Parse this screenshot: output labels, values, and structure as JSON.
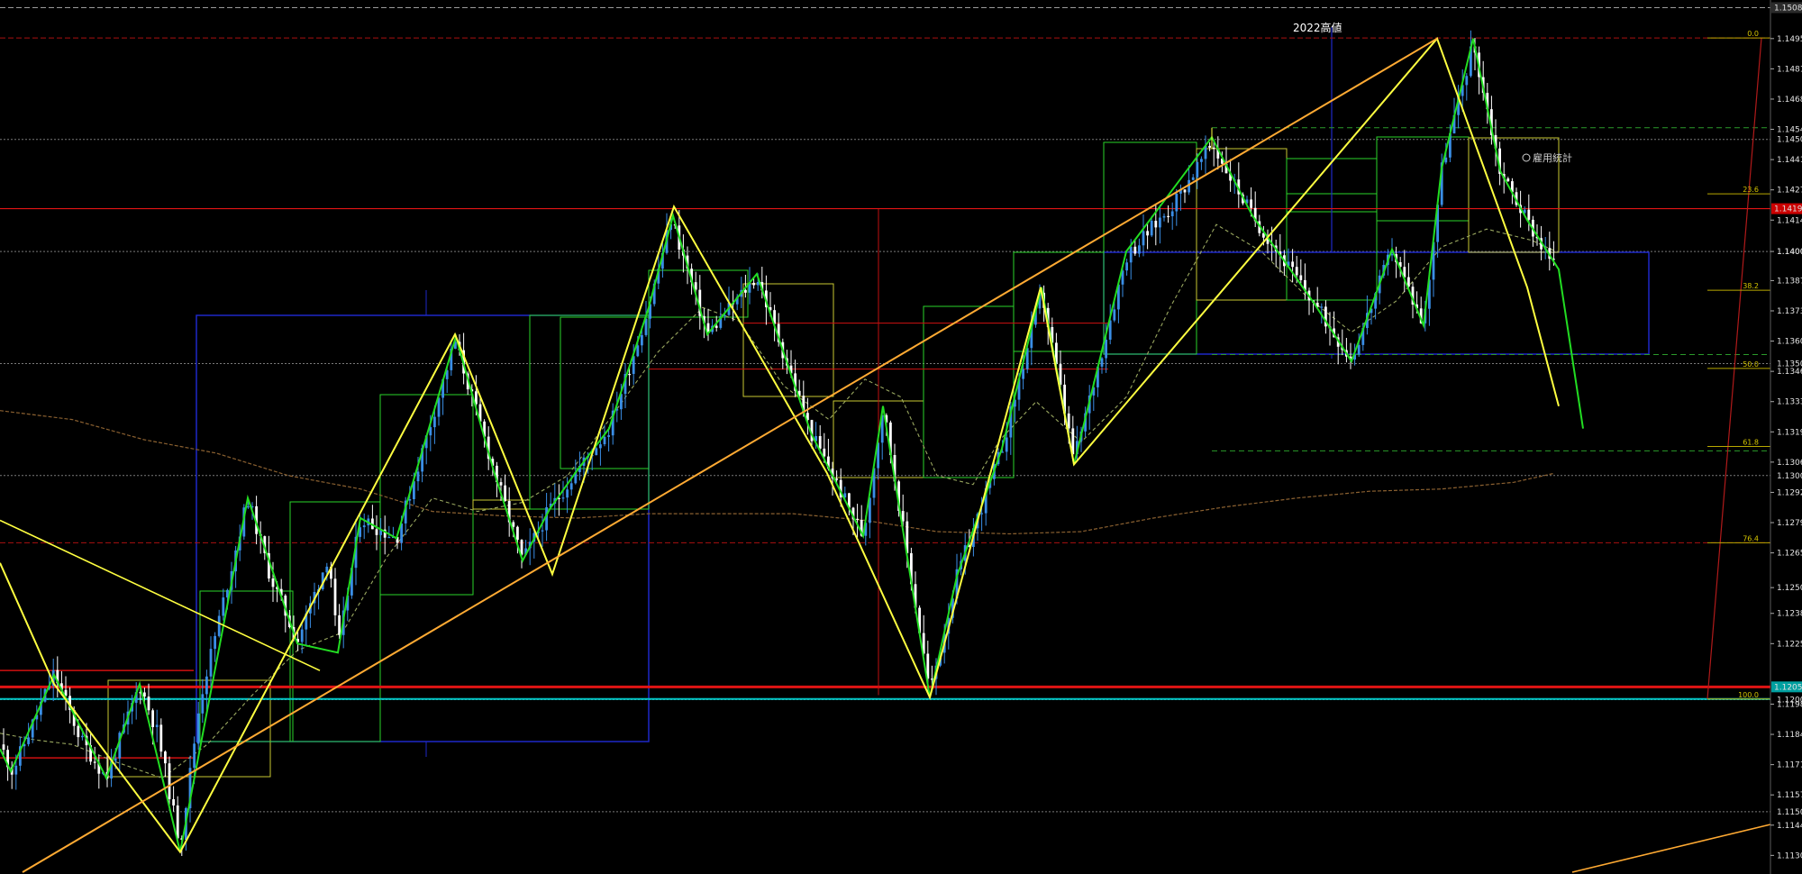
{
  "chart_data": {
    "type": "candlestick",
    "price_axis": {
      "ylim": [
        1.1123,
        1.1509
      ],
      "ticks": [
        "1.14950",
        "1.14815",
        "1.14680",
        "1.14545",
        "1.14410",
        "1.14275",
        "1.14140",
        "1.14000",
        "1.13870",
        "1.13735",
        "1.13600",
        "1.13465",
        "1.13330",
        "1.13195",
        "1.13060",
        "1.12925",
        "1.12790",
        "1.12655",
        "1.12500",
        "1.12385",
        "1.12250",
        "1.11980",
        "1.11845",
        "1.11710",
        "1.11575",
        "1.11440",
        "1.11305"
      ],
      "highlight_labels": [
        {
          "label": "1.15088",
          "price": 1.15088,
          "color": "#2b2b2b"
        },
        {
          "label": "1.14191",
          "price": 1.14191,
          "color": "#cc0000"
        },
        {
          "label": "1.12057",
          "price": 1.12057,
          "color": "#00a0a0"
        }
      ],
      "line_labels": [
        {
          "label": "1.14500",
          "price": 1.145
        },
        {
          "label": "1.14000",
          "price": 1.14
        },
        {
          "label": "1.13500",
          "price": 1.135
        },
        {
          "label": "1.13000",
          "price": 1.13
        },
        {
          "label": "1.12000",
          "price": 1.12
        },
        {
          "label": "1.11500",
          "price": 1.115
        }
      ]
    },
    "grid": true,
    "fibonacci": {
      "levels": [
        {
          "label": "0.0",
          "price": 1.14953
        },
        {
          "label": "23.6",
          "price": 1.14257
        },
        {
          "label": "38.2",
          "price": 1.13827
        },
        {
          "label": "50.0",
          "price": 1.13478
        },
        {
          "label": "61.8",
          "price": 1.1313
        },
        {
          "label": "76.4",
          "price": 1.127
        },
        {
          "label": "100.0",
          "price": 1.12003
        }
      ]
    },
    "annotations": [
      {
        "text": "2022高値"
      },
      {
        "text": "雇用統計"
      }
    ],
    "colors": {
      "background": "#000000",
      "candle_up": "#3a8ee6",
      "candle_down": "#ffffff",
      "zigzag_major": "#ffff40",
      "zigzag_minor": "#22dd22",
      "trendline": "#ffaa33",
      "resistance": "#dd1111",
      "support": "#00c8c8",
      "box_blue": "#1e28c8",
      "ma_fast": "#9aa860",
      "ma_slow": "#8a6030"
    }
  }
}
